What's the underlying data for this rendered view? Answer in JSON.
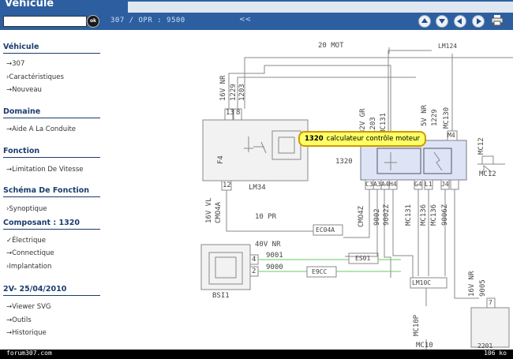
{
  "header": {
    "title": "Véhicule",
    "ok_label": "ok",
    "reference": "307 / OPR : 9500",
    "nav_separator": "<<"
  },
  "sidebar": {
    "sections": [
      {
        "title": "Véhicule",
        "items": [
          "→307",
          "›Caractéristiques",
          "→Nouveau"
        ]
      },
      {
        "title": "Domaine",
        "items": [
          "→Aide A La Conduite"
        ]
      },
      {
        "title": "Fonction",
        "items": [
          "→Limitation De Vitesse"
        ]
      },
      {
        "title": "Schéma De Fonction",
        "items": [
          "›Synoptique"
        ]
      },
      {
        "title": "Composant : 1320",
        "items": [
          "✓Électrique",
          "→Connectique",
          "›Implantation"
        ]
      },
      {
        "title": "2V- 25/04/2010",
        "items": [
          "→Viewer SVG",
          "→Outils",
          "→Historique"
        ]
      }
    ]
  },
  "diagram": {
    "labels": {
      "top_wire": "20 MOT",
      "lm124": "LM124",
      "bsi_conn": "16V NR",
      "w1229": "1229",
      "w1203": "1203",
      "pin13": "13",
      "pin8": "8",
      "f4": "F4",
      "pin12": "12",
      "lm34": "LM34",
      "cmo4a": "CMO4A",
      "v16vl": "16V VL",
      "tenpr": "10 PR",
      "ec04a": "EC04A",
      "v40vnr": "40V NR",
      "w9001": "9001",
      "w9000": "9000",
      "pin4": "4",
      "pin2": "2",
      "es01": "ES01",
      "e9cc": "E9CC",
      "bsi1": "BSI1",
      "c1320": "1320",
      "v32vgr": "32V GR",
      "w1203b": "1203",
      "mc131": "MC131",
      "v5vnr": "5V NR",
      "w1229b": "1229",
      "mc130": "MC130",
      "pinM4": "M4",
      "pinC3": "C3",
      "pinA3": "A3",
      "pinA4": "A4",
      "pinH4": "H4",
      "pinG4": "G4",
      "pinL1": "L1",
      "pinJ4": "J4",
      "cmo4z": "CMO4Z",
      "w9002": "9002",
      "w9002z": "9002Z",
      "mc131b": "MC131",
      "mc136": "MC136",
      "mc136b": "MC136",
      "w9006z": "9006Z",
      "mc12": "MC12",
      "mc12b": "MC12",
      "mc10p": "MC10P",
      "mc10": "MC10",
      "lm10c": "LM10C",
      "v16vnr": "16V NR",
      "w9005": "9005",
      "p7": "7",
      "p2201": "2201"
    },
    "tooltip": {
      "id": "1320",
      "text": "calculateur contrôle moteur"
    }
  },
  "footer": {
    "left": "forum307.com",
    "right": "106 ko"
  }
}
